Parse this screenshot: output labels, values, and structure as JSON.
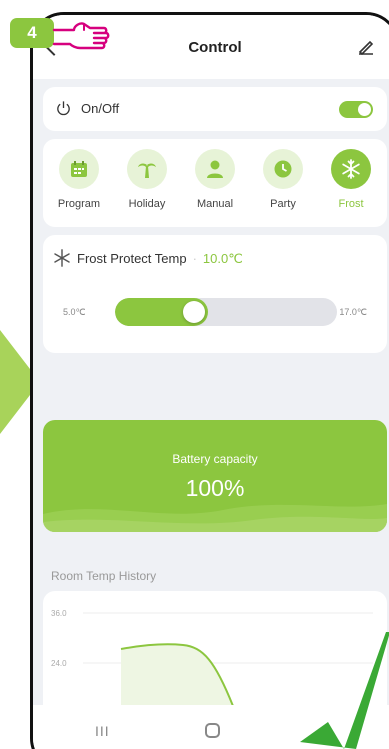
{
  "step_badge": "4",
  "header": {
    "title": "Control"
  },
  "power": {
    "label": "On/Off",
    "state": "on"
  },
  "modes": [
    {
      "label": "Program",
      "icon": "calendar-icon",
      "active": false
    },
    {
      "label": "Holiday",
      "icon": "palm-tree-icon",
      "active": false
    },
    {
      "label": "Manual",
      "icon": "person-icon",
      "active": false
    },
    {
      "label": "Party",
      "icon": "clock-icon",
      "active": false
    },
    {
      "label": "Frost",
      "icon": "snowflake-icon",
      "active": true
    }
  ],
  "frost": {
    "title": "Frost Protect Temp",
    "value": "10.0℃",
    "min_label": "5.0℃",
    "max_label": "17.0℃",
    "level_fraction": 0.42
  },
  "battery": {
    "label": "Battery capacity",
    "value": "100%"
  },
  "history": {
    "title": "Room Temp History",
    "y_ticks": [
      "36.0",
      "24.0"
    ]
  },
  "colors": {
    "accent": "#8cc63f",
    "background": "#eff1f5"
  },
  "navbar": {
    "recent_label": "III"
  }
}
